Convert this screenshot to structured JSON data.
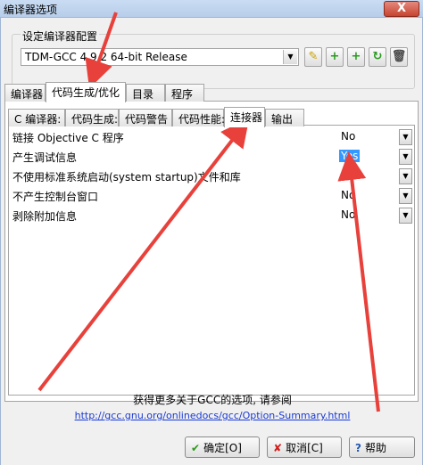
{
  "window": {
    "title": "编译器选项",
    "close_label": "X"
  },
  "compiler_group": {
    "label": "设定编译器配置",
    "selected_profile": "TDM-GCC 4.9.2 64-bit Release",
    "toolbar": [
      "rename-icon",
      "add-icon",
      "add-copy-icon",
      "reset-icon",
      "delete-icon"
    ]
  },
  "main_tabs": [
    "编译器",
    "代码生成/优化",
    "目录",
    "程序"
  ],
  "sub_tabs": [
    "C 编译器:",
    "代码生成:",
    "代码警告",
    "代码性能:",
    "连接器",
    "输出"
  ],
  "options": [
    {
      "label": "链接 Objective C 程序",
      "value": "No"
    },
    {
      "label": "产生调试信息",
      "value": "Yes"
    },
    {
      "label": "不使用标准系统启动(system startup)文件和库",
      "value": "No"
    },
    {
      "label": "不产生控制台窗口",
      "value": "No"
    },
    {
      "label": "剥除附加信息",
      "value": "No"
    }
  ],
  "footer": {
    "info_text": "获得更多关于GCC的选项, 请参阅",
    "link_text": "http://gcc.gnu.org/onlinedocs/gcc/Option-Summary.html",
    "ok_label": "确定[O]",
    "cancel_label": "取消[C]",
    "help_label": "帮助"
  },
  "colors": {
    "selection": "#3399ff",
    "annotation_arrows": "#e8413b"
  }
}
